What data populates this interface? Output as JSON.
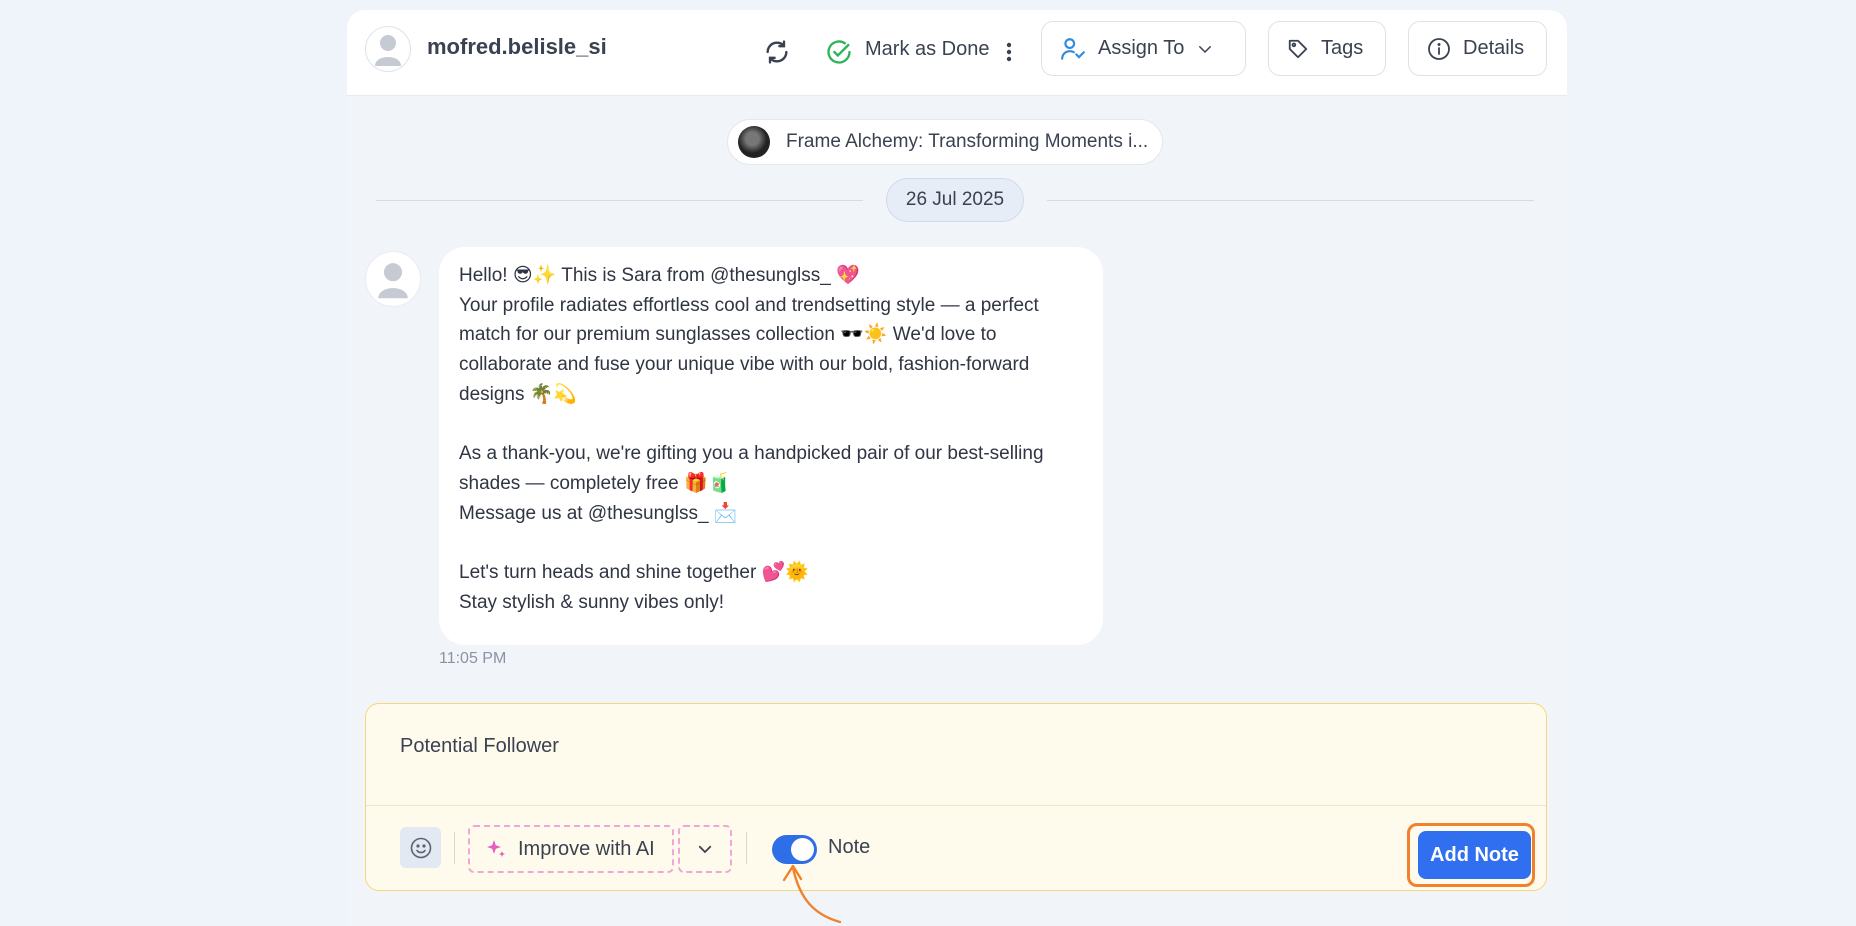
{
  "header": {
    "username": "mofred.belisle_si",
    "mark_done_label": "Mark as Done",
    "assign_label": "Assign To",
    "tags_label": "Tags",
    "details_label": "Details"
  },
  "post_chip": {
    "title": "Frame Alchemy: Transforming Moments i..."
  },
  "date_separator": "26 Jul 2025",
  "message": {
    "text": "Hello! 😎✨ This is Sara from @thesunglss_ 💖\nYour profile radiates effortless cool and trendsetting style — a perfect match for our premium sunglasses collection 🕶️☀️ We'd love to collaborate and fuse your unique vibe with our bold, fashion-forward designs 🌴💫\n\nAs a thank-you, we're gifting you a handpicked pair of our best-selling shades — completely free 🎁🧃\nMessage us at @thesunglss_ 📩\n\nLet's turn heads and shine together 💕🌞\nStay stylish & sunny vibes only!",
    "time": "11:05 PM"
  },
  "composer": {
    "text": "Potential Follower",
    "improve_label": "Improve with AI",
    "note_label": "Note",
    "note_enabled": true,
    "submit_label": "Add Note"
  },
  "colors": {
    "accent": "#2f6ff0",
    "highlight": "#f0822d",
    "done_green": "#2fb35a",
    "ai_pink": "#f0a6d6"
  },
  "icons": [
    "user-avatar-icon",
    "refresh-icon",
    "check-circle-icon",
    "more-vertical-icon",
    "user-check-icon",
    "chevron-down-icon",
    "tag-icon",
    "info-icon",
    "smiley-icon",
    "sparkle-icon"
  ]
}
